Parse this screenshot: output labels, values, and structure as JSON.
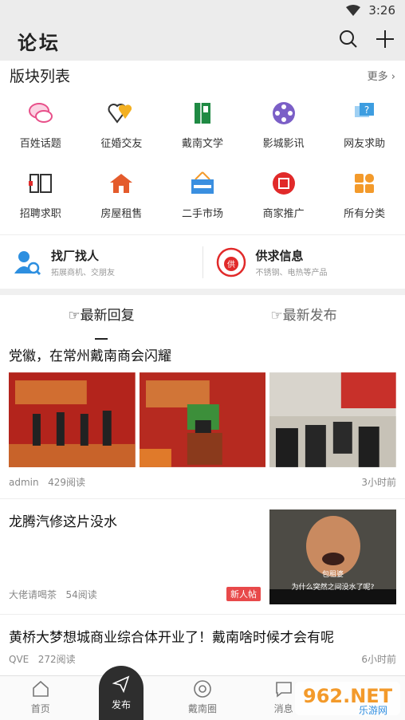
{
  "status_bar": {
    "time": "3:26"
  },
  "header": {
    "title": "论坛"
  },
  "boards": {
    "title": "版块列表",
    "more_label": "更多",
    "items": [
      {
        "label": "百姓话题",
        "icon": "chat-bubbles-icon",
        "color": "#e8508a"
      },
      {
        "label": "征婚交友",
        "icon": "hearts-icon",
        "color": "#f3b021"
      },
      {
        "label": "戴南文学",
        "icon": "book-icon",
        "color": "#1f8a43"
      },
      {
        "label": "影城影讯",
        "icon": "film-reel-icon",
        "color": "#7b5fc7"
      },
      {
        "label": "网友求助",
        "icon": "help-bubble-icon",
        "color": "#3d9de0"
      },
      {
        "label": "招聘求职",
        "icon": "recruit-icon",
        "color": "#333333"
      },
      {
        "label": "房屋租售",
        "icon": "house-icon",
        "color": "#e45b2c"
      },
      {
        "label": "二手市场",
        "icon": "secondhand-sign-icon",
        "color": "#3a8fe0"
      },
      {
        "label": "商家推广",
        "icon": "promo-badge-icon",
        "color": "#e12a2a"
      },
      {
        "label": "所有分类",
        "icon": "categories-icon",
        "color": "#f39a2b"
      }
    ]
  },
  "promo": {
    "left": {
      "title": "找厂找人",
      "subtitle": "拓展商机、交朋友"
    },
    "right": {
      "title": "供求信息",
      "subtitle": "不锈钢、电热等产品",
      "badge_text": "供"
    }
  },
  "feed_tabs": [
    {
      "label": "☞最新回复",
      "active": true
    },
    {
      "label": "☞最新发布",
      "active": false
    }
  ],
  "posts": [
    {
      "title": "党徽，在常州戴南商会闪耀",
      "author": "admin",
      "views": "429阅读",
      "time": "3小时前"
    },
    {
      "title": "龙腾汽修这片没水",
      "author": "大佬请喝茶",
      "views": "54阅读",
      "badge": "新人帖",
      "caption1": "包租婆",
      "caption2": "为什么突然之间没水了呢?"
    },
    {
      "title": "黄桥大梦想城商业综合体开业了！戴南啥时候才会有呢",
      "author": "QVE",
      "views": "272阅读",
      "time": "6小时前"
    }
  ],
  "tabbar": {
    "home": "首页",
    "publish": "发布",
    "circle": "戴南圈",
    "messages": "消息"
  },
  "watermark": {
    "brand": "962.NET",
    "sub": "乐游网"
  }
}
